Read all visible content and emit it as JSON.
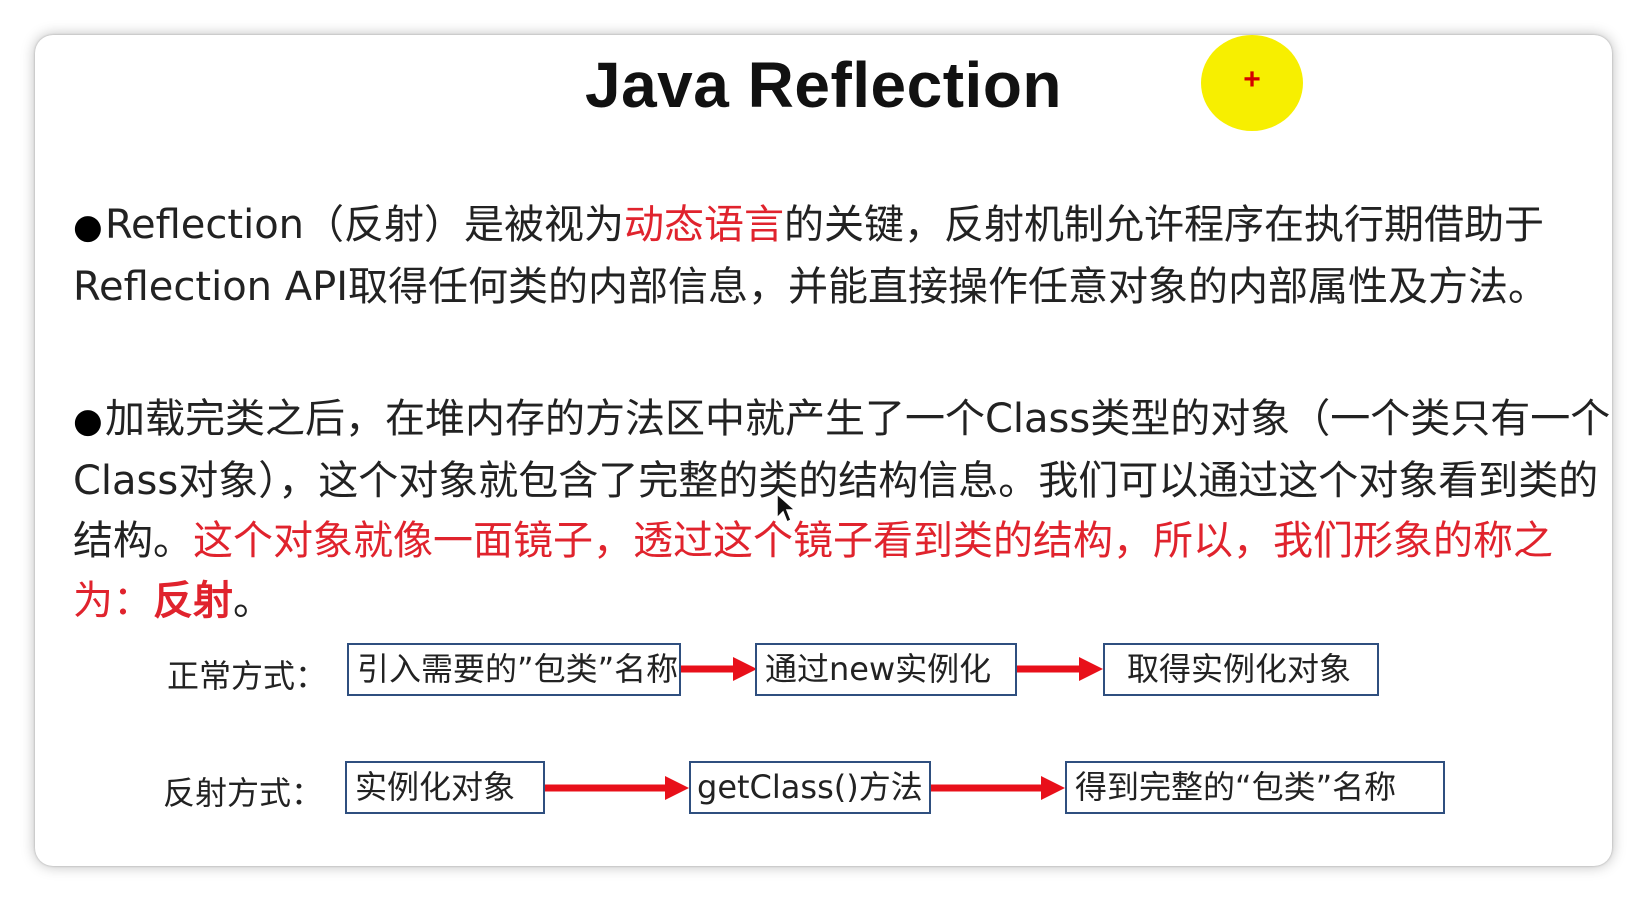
{
  "slide": {
    "title": "Java Reflection",
    "cursor_marker": "+",
    "para1": {
      "bullet": "●",
      "t1": "Reflection（反射）是被视为",
      "t2_red": "动态语言",
      "t3": "的关键，反射机制允许程序在执行期借助于Reflection API取得任何类的内部信息，并能直接操作任意对象的内部属性及方法。"
    },
    "para2": {
      "bullet": "●",
      "t1": "加载完类之后，在堆内存的方法区中就产生了一个Class类型的对象（一个类只有一个Class对象），这个对象就包含了完整的类的结构信息。我们可以通过这个对象看到类的结构。",
      "t2_red": "这个对象就像一面镜子，透过这个镜子看到类的结构，所以，我们形象的称之为：",
      "t3_red_bold": "反射",
      "t4": "。"
    },
    "normal_flow": {
      "label": "正常方式：",
      "steps": [
        "引入需要的”包类”名称",
        "通过new实例化",
        "取得实例化对象"
      ]
    },
    "reflect_flow": {
      "label": "反射方式：",
      "steps": [
        "实例化对象",
        "getClass()方法",
        "得到完整的“包类”名称"
      ]
    },
    "colors": {
      "accent_red": "#e0232d",
      "arrow_red": "#e8101a",
      "box_border": "#2f4f7f",
      "cursor_highlight": "#f7ef00"
    },
    "icons": {
      "bullet": "bullet-dot-icon",
      "arrow": "right-arrow-icon",
      "cursor": "mouse-pointer-icon"
    }
  }
}
